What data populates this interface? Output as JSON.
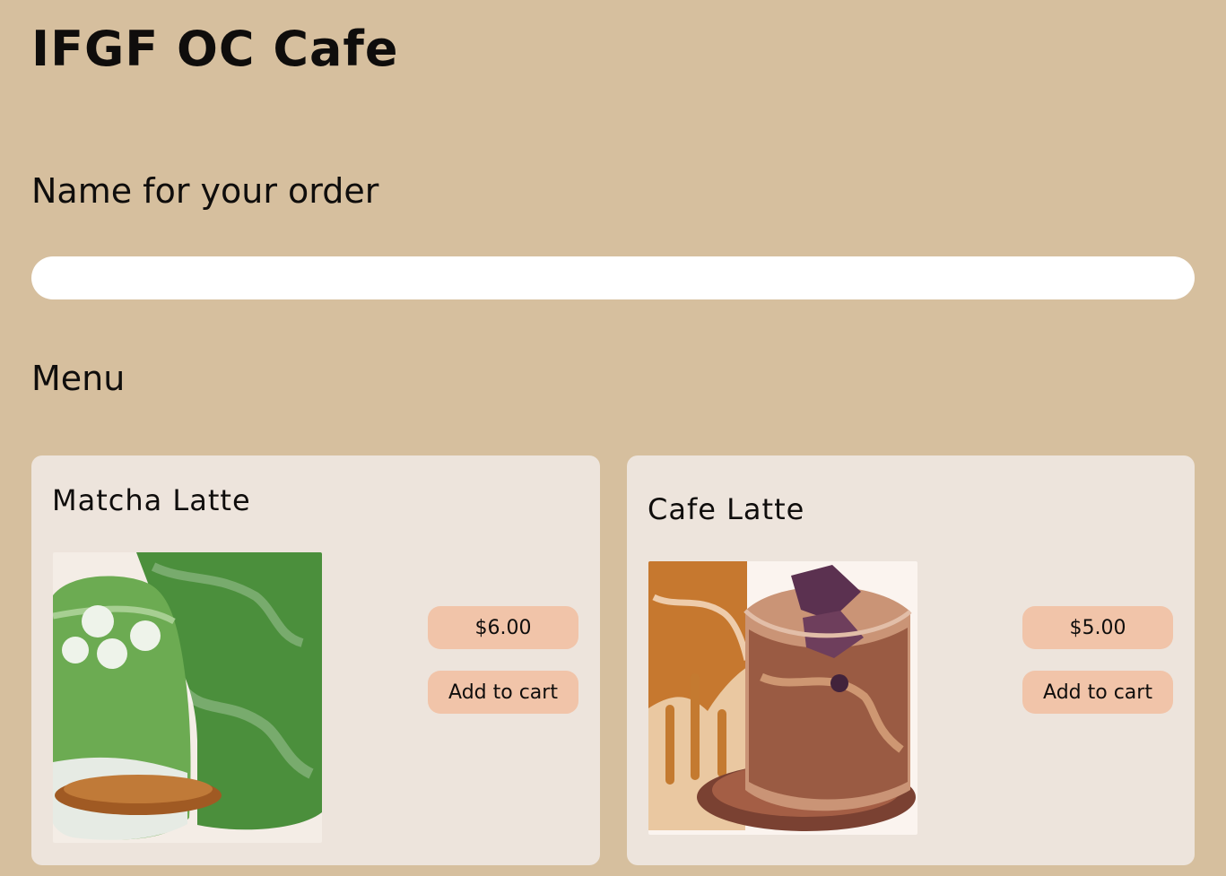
{
  "header": {
    "title": "IFGF OC Cafe"
  },
  "order_form": {
    "label": "Name for your order",
    "value": "",
    "placeholder": ""
  },
  "menu": {
    "heading": "Menu",
    "items": [
      {
        "name": "Matcha Latte",
        "price": "$6.00",
        "button_label": "Add to cart",
        "image_icon": "matcha-latte-image"
      },
      {
        "name": "Cafe Latte",
        "price": "$5.00",
        "button_label": "Add to cart",
        "image_icon": "cafe-latte-image"
      }
    ]
  },
  "colors": {
    "background": "#d6bf9e",
    "card": "#ede4dc",
    "button": "#f1c4a9",
    "input": "#ffffff",
    "text": "#0f0d0c"
  }
}
